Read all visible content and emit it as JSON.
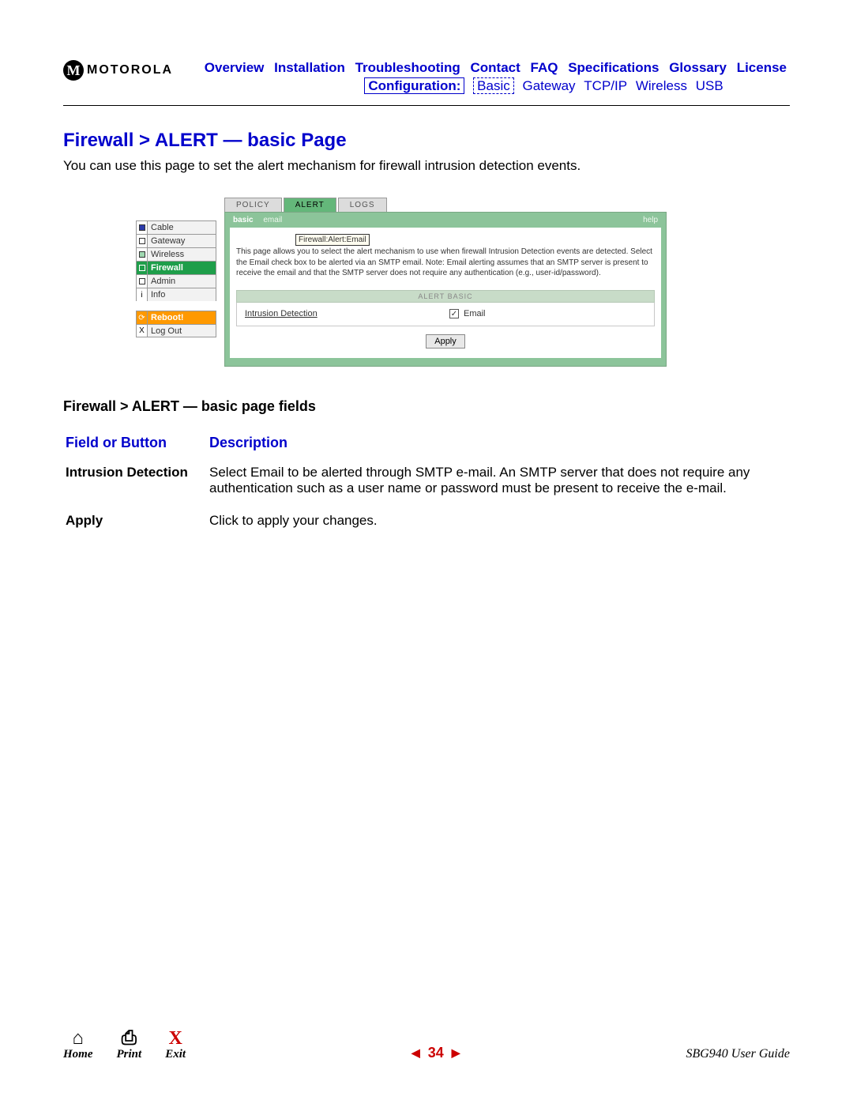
{
  "brand": "MOTOROLA",
  "nav": {
    "links": [
      "Overview",
      "Installation",
      "Troubleshooting",
      "Contact",
      "FAQ",
      "Specifications",
      "Glossary",
      "License"
    ],
    "sub": {
      "label": "Configuration:",
      "active": "Basic",
      "others": [
        "Gateway",
        "TCP/IP",
        "Wireless",
        "USB"
      ]
    }
  },
  "title": "Firewall > ALERT — basic Page",
  "intro": "You can use this page to set the alert mechanism for firewall intrusion detection events.",
  "sideMenu": {
    "items": [
      "Cable",
      "Gateway",
      "Wireless",
      "Firewall",
      "Admin",
      "Info"
    ],
    "reboot": "Reboot!",
    "logout": "Log Out"
  },
  "tabs": {
    "items": [
      "POLICY",
      "ALERT",
      "LOGS"
    ],
    "active": 1
  },
  "subtabs": {
    "items": [
      "basic",
      "email"
    ],
    "active": 0,
    "help": "help"
  },
  "tooltip": "Firewall:Alert:Email",
  "panelDesc": "This page allows you to select the alert mechanism to use when firewall Intrusion Detection events are detected. Select the Email check box to be alerted via an SMTP email. Note: Email alerting assumes that an SMTP server is present to receive the email and that the SMTP server does not require any authentication (e.g., user-id/password).",
  "alertBasicHeader": "ALERT BASIC",
  "formRow": {
    "label": "Intrusion Detection",
    "checkLabel": "Email",
    "checked": true
  },
  "applyLabel": "Apply",
  "sectionSub": "Firewall > ALERT — basic page fields",
  "tableHead": {
    "c1": "Field or Button",
    "c2": "Description"
  },
  "tableRows": [
    {
      "name": "Intrusion Detection",
      "desc": "Select Email to be alerted through SMTP e-mail. An SMTP server that does not require any authentication such as a user name or password must be present to receive the e-mail."
    },
    {
      "name": "Apply",
      "desc": "Click to apply your changes."
    }
  ],
  "footer": {
    "home": "Home",
    "print": "Print",
    "exit": "Exit",
    "page": "34",
    "guide": "SBG940 User Guide"
  }
}
